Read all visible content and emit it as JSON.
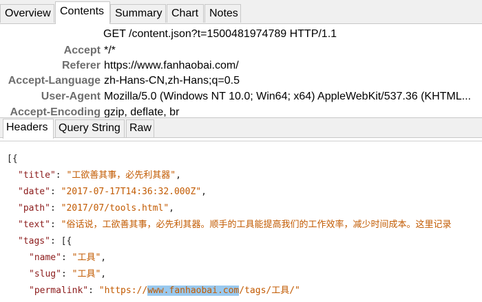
{
  "tabs": [
    "Overview",
    "Contents",
    "Summary",
    "Chart",
    "Notes"
  ],
  "request_line": "GET /content.json?t=1500481974789 HTTP/1.1",
  "headers": [
    {
      "key": "Accept",
      "value": "*/*"
    },
    {
      "key": "Referer",
      "value": "https://www.fanhaobai.com/"
    },
    {
      "key": "Accept-Language",
      "value": "zh-Hans-CN,zh-Hans;q=0.5"
    },
    {
      "key": "User-Agent",
      "value": "Mozilla/5.0 (Windows NT 10.0; Win64; x64) AppleWebKit/537.36 (KHTML..."
    },
    {
      "key": "Accept-Encoding",
      "value": "gzip, deflate, br"
    }
  ],
  "subtabs": [
    "Headers",
    "Query String",
    "Raw"
  ],
  "json_view": {
    "open": "[{",
    "title_key": "\"title\"",
    "title_val": "\"工欲善其事，必先利其器\"",
    "date_key": "\"date\"",
    "date_val": "\"2017-07-17T14:36:32.000Z\"",
    "path_key": "\"path\"",
    "path_val": "\"2017/07/tools.html\"",
    "text_key": "\"text\"",
    "text_val": "\"俗话说，工欲善其事，必先利其器。顺手的工具能提高我们的工作效率，减少时间成本。这里记录",
    "tags_key": "\"tags\"",
    "tags_open": "[{",
    "name_key": "\"name\"",
    "name_val": "\"工具\"",
    "slug_key": "\"slug\"",
    "slug_val": "\"工具\"",
    "permalink_key": "\"permalink\"",
    "permalink_pre": "\"https://",
    "permalink_hl": "www.fanhaobai.com",
    "permalink_post": "/tags/工具/\"",
    "close": "}]"
  }
}
